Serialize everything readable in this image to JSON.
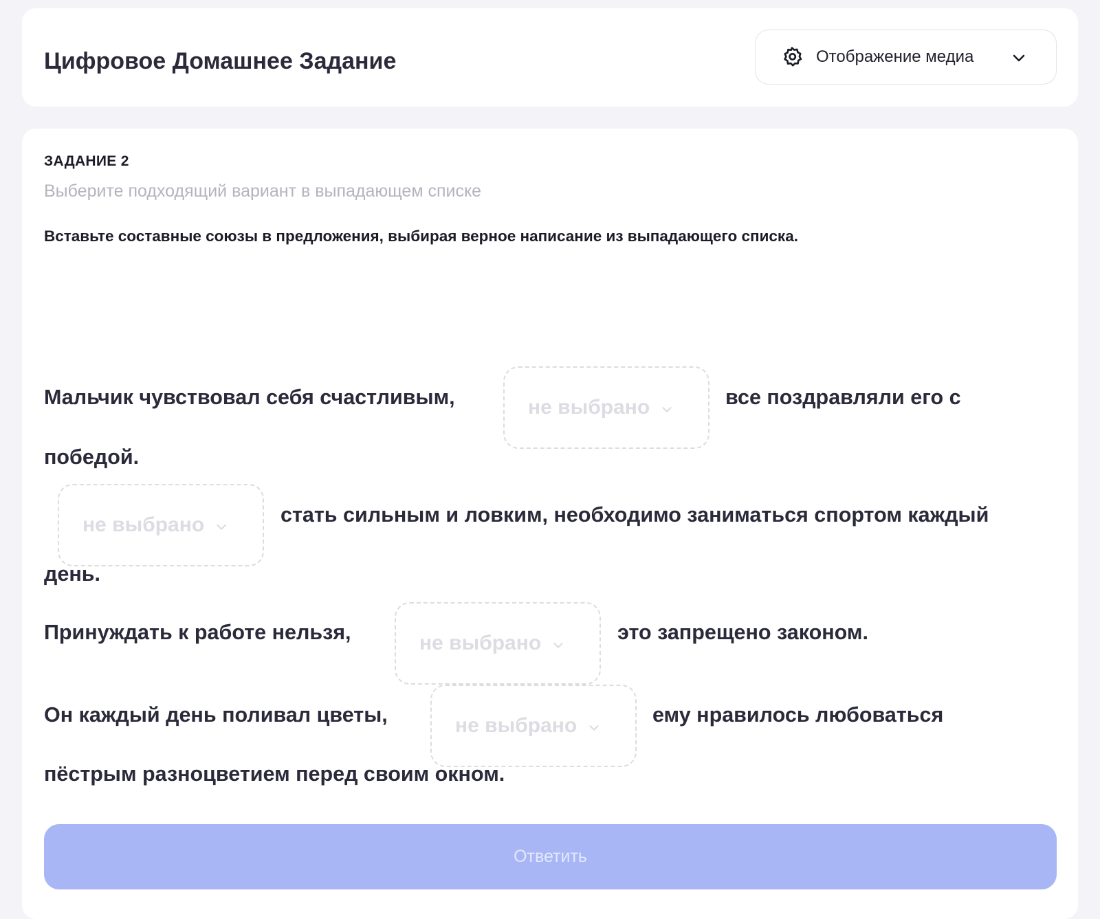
{
  "header": {
    "title": "Цифровое Домашнее Задание",
    "media_button_label": "Отображение медиа"
  },
  "task": {
    "number_label": "ЗАДАНИЕ 2",
    "hint": "Выберите подходящий вариант в выпадающем списке",
    "instruction": "Вставьте составные союзы в предложения, выбирая верное написание из выпадающего списка.",
    "sentences": [
      {
        "before": "Мальчик чувствовал себя счастливым,",
        "after": "все поздравляли его с",
        "continuation": "победой."
      },
      {
        "before": "",
        "after": "стать сильным и ловким, необходимо заниматься спортом каждый",
        "continuation": "день."
      },
      {
        "before": "Принуждать к работе нельзя,",
        "after": "это запрещено законом.",
        "continuation": ""
      },
      {
        "before": "Он каждый день поливал цветы,",
        "after": "ему нравилось любоваться",
        "continuation": "пёстрым разноцветием перед своим окном."
      }
    ],
    "select_placeholder": "не выбрано",
    "submit_label": "Ответить"
  },
  "colors": {
    "background": "#f3f3f8",
    "card": "#ffffff",
    "primary_text": "#2a2a3a",
    "hint_text": "#b4b4be",
    "select_border": "#dcdce2",
    "submit_bg": "#a8b6f6",
    "submit_text": "#e3e8fd"
  },
  "icons": {
    "media": "gear-icon",
    "media_chevron": "chevron-down-icon",
    "select_chevron": "chevron-down-icon"
  }
}
